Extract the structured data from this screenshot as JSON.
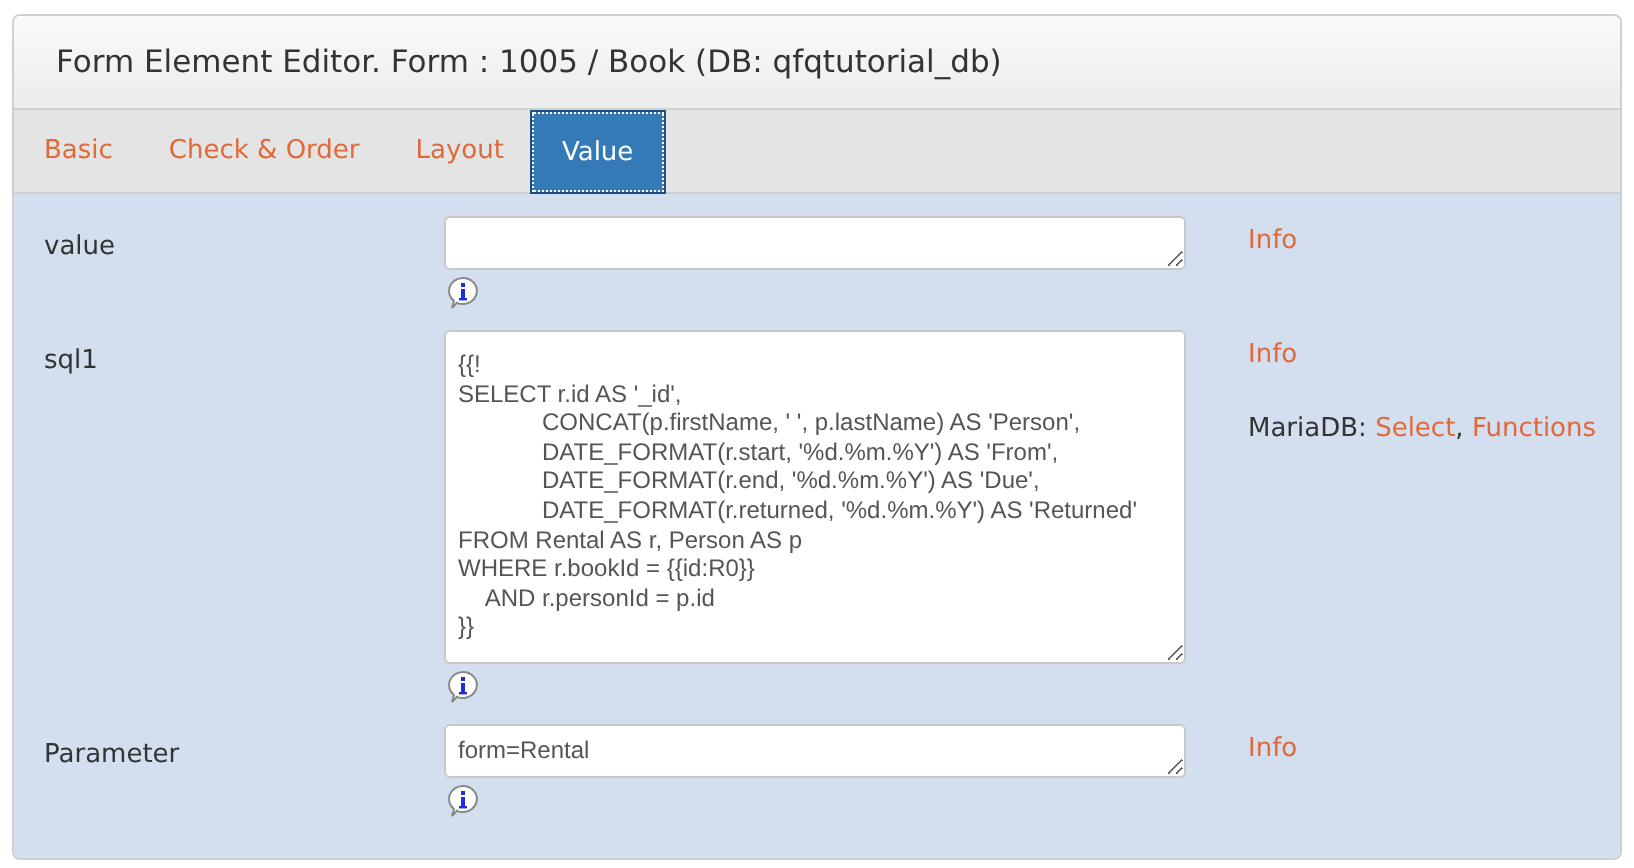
{
  "panel": {
    "title": "Form Element Editor. Form : 1005 / Book (DB: qfqtutorial_db)"
  },
  "tabs": [
    {
      "label": "Basic",
      "selected": false
    },
    {
      "label": "Check & Order",
      "selected": false
    },
    {
      "label": "Layout",
      "selected": false
    },
    {
      "label": "Value",
      "selected": true
    }
  ],
  "fields": [
    {
      "label": "value",
      "kind": "short",
      "info_link": "Info"
    },
    {
      "label": "sql1",
      "value": "{{!\nSELECT r.id AS '_id',\n\t\tCONCAT(p.firstName, ' ', p.lastName) AS 'Person',\n\t\tDATE_FORMAT(r.start, '%d.%m.%Y') AS 'From',\n\t\tDATE_FORMAT(r.end, '%d.%m.%Y') AS 'Due',\n\t\tDATE_FORMAT(r.returned, '%d.%m.%Y') AS 'Returned'\nFROM Rental AS r, Person AS p\nWHERE r.bookId = {{id:R0}}\n    AND r.personId = p.id\n}}",
      "kind": "tall",
      "info_link": "Info",
      "note": {
        "prefix": "MariaDB:",
        "links": [
          "Select",
          "Functions"
        ],
        "separator": ","
      }
    },
    {
      "label": "Parameter",
      "value": "form=Rental",
      "kind": "short",
      "info_link": "Info"
    }
  ]
}
